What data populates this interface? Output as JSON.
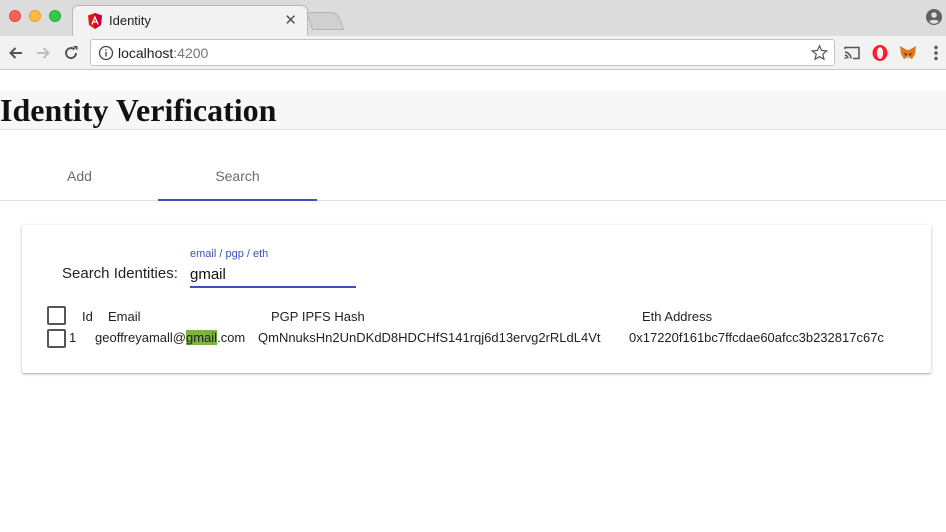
{
  "browser": {
    "tab_title": "Identity",
    "url_host": "localhost",
    "url_port": ":4200"
  },
  "page": {
    "title": "Identity Verification",
    "tabs": [
      {
        "label": "Add",
        "active": false
      },
      {
        "label": "Search",
        "active": true
      }
    ]
  },
  "search": {
    "label": "Search Identities:",
    "hint": "email / pgp / eth",
    "value": "gmail"
  },
  "table": {
    "columns": [
      "Id",
      "Email",
      "PGP IPFS Hash",
      "Eth Address"
    ],
    "rows": [
      {
        "id": "1",
        "email_before": "geoffreyamall@",
        "email_match": "gmail",
        "email_after": ".com",
        "pgp_hash": "QmNnuksHn2UnDKdD8HDCHfS141rqj6d13ervg2rRLdL4Vt",
        "eth_address": "0x17220f161bc7ffcdae60afcc3b232817c67c"
      }
    ]
  },
  "colors": {
    "accent": "#3f51b5",
    "highlight": "#7cb342"
  }
}
